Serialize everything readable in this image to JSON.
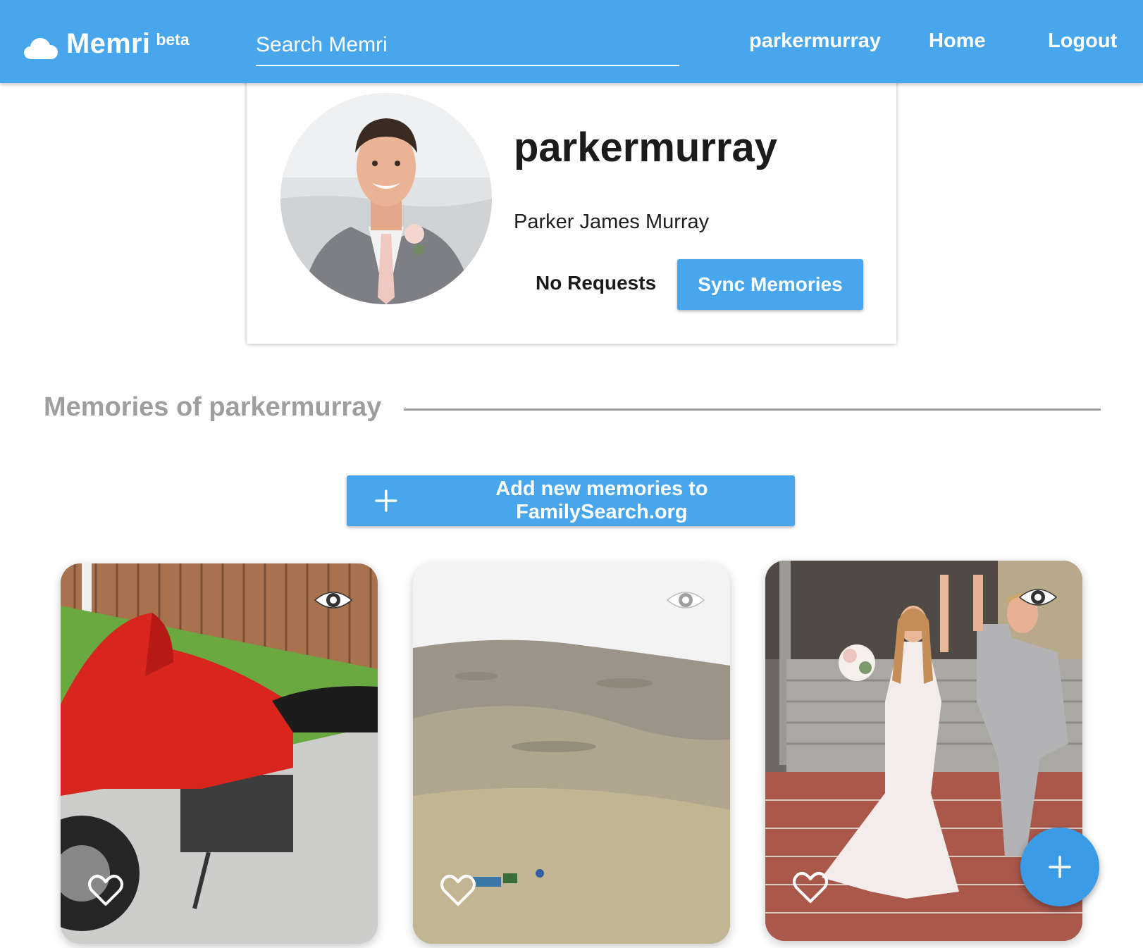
{
  "header": {
    "brand": "Memri",
    "brand_badge": "beta",
    "search_placeholder": "Search Memri",
    "nav": {
      "username": "parkermurray",
      "home": "Home",
      "logout": "Logout"
    }
  },
  "profile": {
    "username": "parkermurray",
    "full_name": "Parker James Murray",
    "requests_label": "No Requests",
    "sync_button": "Sync Memories"
  },
  "memories": {
    "section_title": "Memories of parkermurray",
    "add_button": "Add new memories to FamilySearch.org",
    "cards": [
      {
        "subject": "red motorcycle parked by wooden fence",
        "liked": false,
        "visible": true
      },
      {
        "subject": "dry grassy hillside landscape",
        "liked": false,
        "visible": true
      },
      {
        "subject": "bride and groom celebrating outside building",
        "liked": false,
        "visible": true
      }
    ]
  },
  "colors": {
    "primary": "#48a6ec",
    "section_gray": "#9e9e9e",
    "text_dark": "#1b1b1b"
  },
  "icons": {
    "logo": "cloud-icon",
    "card_view": "eye-icon",
    "card_like": "heart-outline-icon",
    "add": "plus-icon"
  }
}
